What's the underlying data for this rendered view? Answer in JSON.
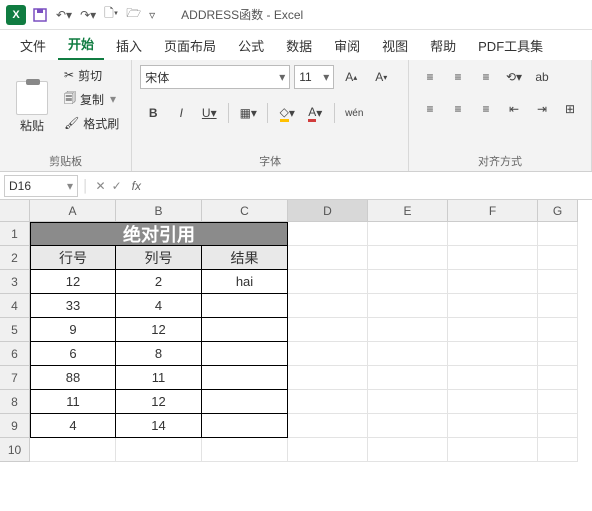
{
  "title": "ADDRESS函数 - Excel",
  "tabs": [
    "文件",
    "开始",
    "插入",
    "页面布局",
    "公式",
    "数据",
    "审阅",
    "视图",
    "帮助",
    "PDF工具集"
  ],
  "active_tab": "开始",
  "clipboard": {
    "paste": "粘贴",
    "cut": "剪切",
    "copy": "复制",
    "format_painter": "格式刷",
    "label": "剪贴板"
  },
  "font": {
    "name": "宋体",
    "size": "11",
    "bold": "B",
    "italic": "I",
    "underline": "U",
    "wen": "wén",
    "label": "字体"
  },
  "align": {
    "label": "对齐方式"
  },
  "namebox": "D16",
  "fx": "fx",
  "cols": [
    "A",
    "B",
    "C",
    "D",
    "E",
    "F",
    "G"
  ],
  "rows": [
    "1",
    "2",
    "3",
    "4",
    "5",
    "6",
    "7",
    "8",
    "9",
    "10"
  ],
  "merged_title": "绝对引用",
  "headers": {
    "r": "行号",
    "c": "列号",
    "res": "结果"
  },
  "data": [
    {
      "r": "12",
      "c": "2",
      "res": "hai"
    },
    {
      "r": "33",
      "c": "4",
      "res": ""
    },
    {
      "r": "9",
      "c": "12",
      "res": ""
    },
    {
      "r": "6",
      "c": "8",
      "res": ""
    },
    {
      "r": "88",
      "c": "11",
      "res": ""
    },
    {
      "r": "11",
      "c": "12",
      "res": ""
    },
    {
      "r": "4",
      "c": "14",
      "res": ""
    }
  ],
  "selected_cell": "D16"
}
